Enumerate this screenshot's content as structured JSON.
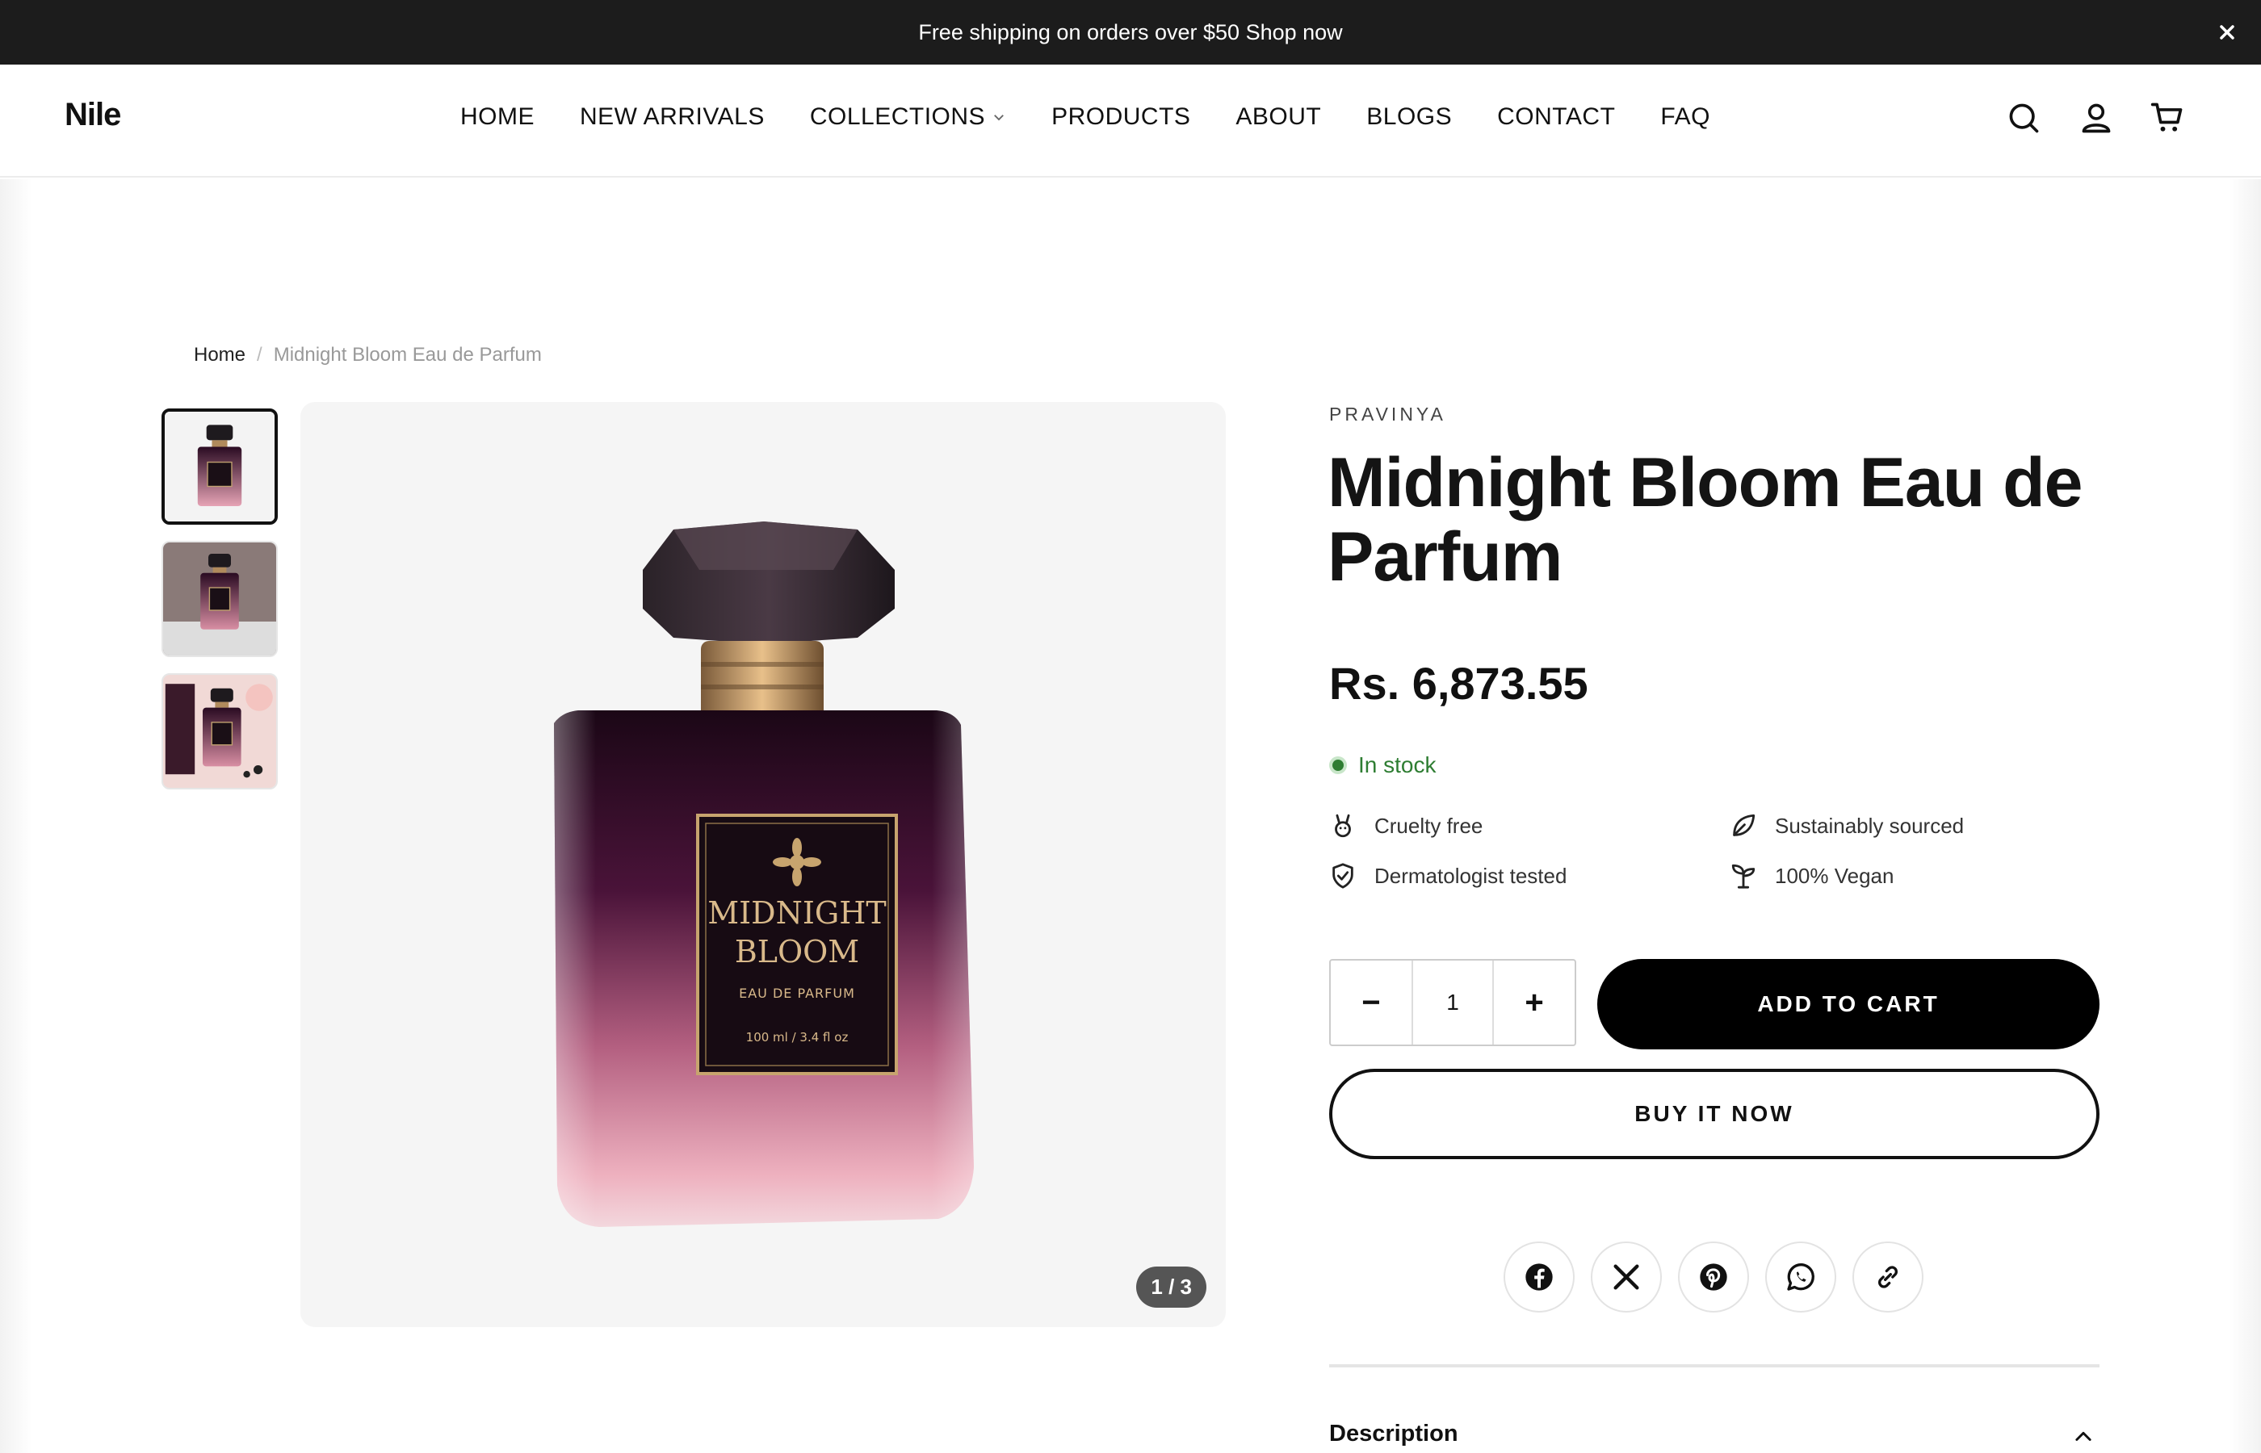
{
  "announcement": {
    "text": "Free shipping on orders over $50 Shop now",
    "close_icon": "close-icon"
  },
  "header": {
    "logo": "Nile",
    "nav": [
      "HOME",
      "NEW ARRIVALS",
      "COLLECTIONS",
      "PRODUCTS",
      "ABOUT",
      "BLOGS",
      "CONTACT",
      "FAQ"
    ],
    "icons": [
      "search-icon",
      "account-icon",
      "cart-icon"
    ]
  },
  "breadcrumb": {
    "home": "Home",
    "separator": "/",
    "current": "Midnight Bloom Eau de Parfum"
  },
  "gallery": {
    "counter": "1 / 3",
    "label_line1": "MIDNIGHT",
    "label_line2": "BLOOM",
    "label_line3": "EAU DE PARFUM",
    "label_line4": "100 ml / 3.4 fl oz"
  },
  "product": {
    "vendor": "PRAVINYA",
    "title": "Midnight Bloom Eau de Parfum",
    "price": "Rs. 6,873.55",
    "stock": "In stock",
    "features": [
      "Cruelty free",
      "Sustainably sourced",
      "Dermatologist tested",
      "100% Vegan"
    ],
    "quantity": "1",
    "minus": "−",
    "plus": "+",
    "add_to_cart": "ADD TO CART",
    "buy_now": "BUY IT NOW",
    "description_label": "Description"
  },
  "social": [
    "facebook-icon",
    "x-icon",
    "pinterest-icon",
    "whatsapp-icon",
    "link-icon"
  ],
  "colors": {
    "accent": "#000000",
    "stock_green": "#2e7d32",
    "announcement_bg": "#1c1c1c",
    "bottle_purple": "#3a1030",
    "bottle_pink": "#e8a0b0"
  }
}
